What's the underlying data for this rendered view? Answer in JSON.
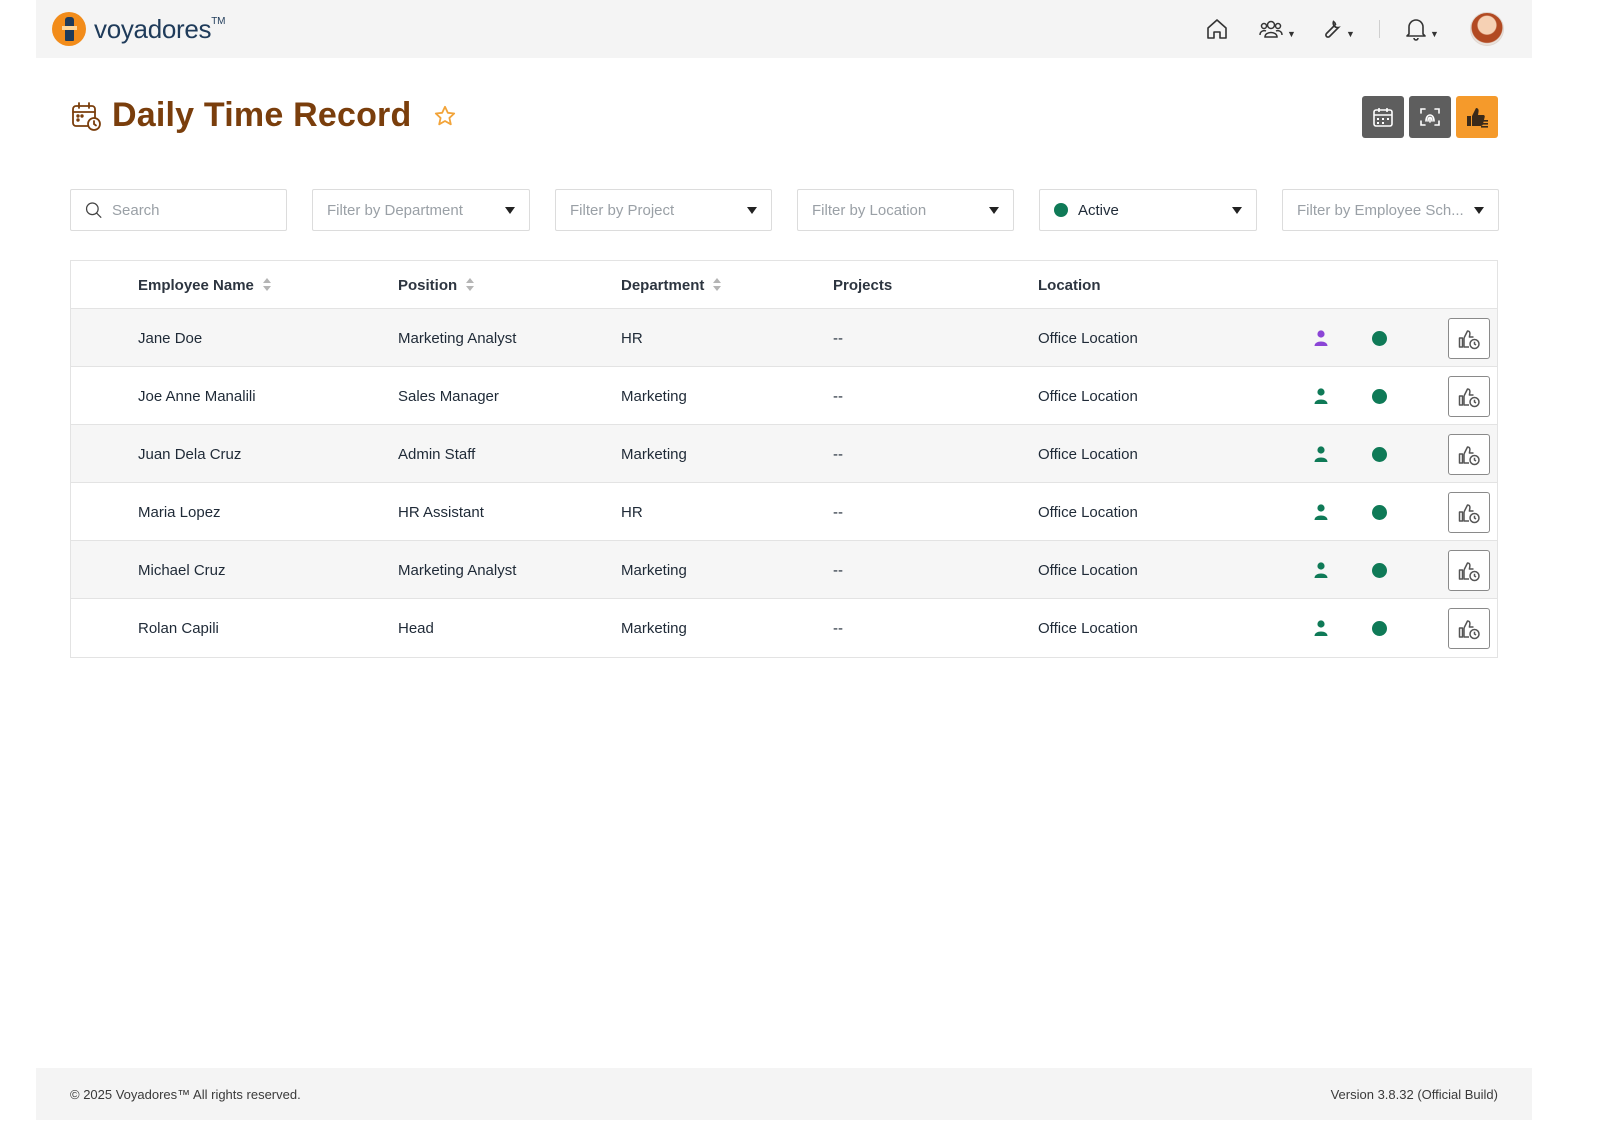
{
  "app": {
    "name": "voyadores",
    "trademark": "TM"
  },
  "page": {
    "title": "Daily Time Record"
  },
  "filters": {
    "search_placeholder": "Search",
    "department": "Filter by Department",
    "project": "Filter by Project",
    "location": "Filter by Location",
    "status": "Active",
    "schedule": "Filter by Employee Sch..."
  },
  "table": {
    "headers": {
      "name": "Employee Name",
      "position": "Position",
      "department": "Department",
      "projects": "Projects",
      "location": "Location"
    },
    "rows": [
      {
        "name": "Jane Doe",
        "position": "Marketing Analyst",
        "department": "HR",
        "projects": "--",
        "location": "Office Location",
        "person_color": "#8b45d6"
      },
      {
        "name": "Joe Anne Manalili",
        "position": "Sales Manager",
        "department": "Marketing",
        "projects": "--",
        "location": "Office Location",
        "person_color": "#0f7a57"
      },
      {
        "name": "Juan Dela Cruz",
        "position": "Admin Staff",
        "department": "Marketing",
        "projects": "--",
        "location": "Office Location",
        "person_color": "#0f7a57"
      },
      {
        "name": "Maria Lopez",
        "position": "HR Assistant",
        "department": "HR",
        "projects": "--",
        "location": "Office Location",
        "person_color": "#0f7a57"
      },
      {
        "name": "Michael Cruz",
        "position": "Marketing Analyst",
        "department": "Marketing",
        "projects": "--",
        "location": "Office Location",
        "person_color": "#0f7a57"
      },
      {
        "name": "Rolan Capili",
        "position": "Head",
        "department": "Marketing",
        "projects": "--",
        "location": "Office Location",
        "person_color": "#0f7a57"
      }
    ]
  },
  "footer": {
    "copyright": "© 2025 Voyadores™ All rights reserved.",
    "version": "Version 3.8.32 (Official Build)"
  },
  "colors": {
    "brand_orange": "#f28c1a",
    "title_brown": "#7a3e0c",
    "status_green": "#0f7a57",
    "purple": "#8b45d6"
  },
  "icons": {
    "nav": [
      "home-icon",
      "team-icon",
      "tools-icon",
      "bell-icon"
    ],
    "actions": [
      "calendar-icon",
      "face-scan-icon",
      "approve-icon"
    ]
  }
}
